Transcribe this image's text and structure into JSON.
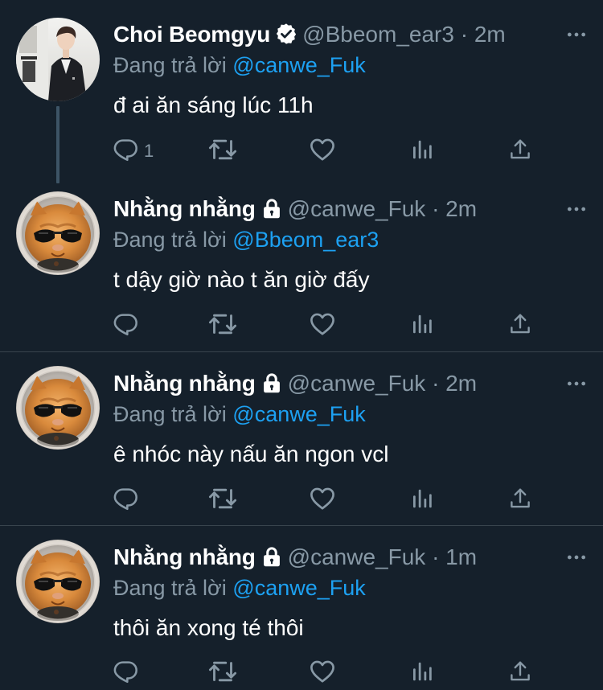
{
  "colors": {
    "background": "#15202b",
    "primary_text": "#ffffff",
    "secondary_text": "#8899a6",
    "accent": "#1da1f2",
    "divider": "#38444d",
    "thread_line": "#3d5466"
  },
  "tweets": [
    {
      "author_name": "Choi Beomgyu",
      "verified": true,
      "protected": false,
      "handle": "@Bbeom_ear3",
      "dot": "·",
      "time": "2m",
      "replying_prefix": "Đang trả lời",
      "replying_to": "@canwe_Fuk",
      "text": "đ ai ăn sáng lúc 11h",
      "reply_count": "1",
      "icons": [
        "verified-badge-icon",
        "more-icon",
        "reply-icon",
        "retweet-icon",
        "like-icon",
        "stats-icon",
        "share-icon"
      ]
    },
    {
      "author_name": "Nhằng nhằng",
      "verified": false,
      "protected": true,
      "handle": "@canwe_Fuk",
      "dot": "·",
      "time": "2m",
      "replying_prefix": "Đang trả lời",
      "replying_to": "@Bbeom_ear3",
      "text": "t dậy giờ nào t ăn giờ đấy",
      "reply_count": "",
      "icons": [
        "lock-icon",
        "more-icon",
        "reply-icon",
        "retweet-icon",
        "like-icon",
        "stats-icon",
        "share-icon"
      ]
    },
    {
      "author_name": "Nhằng nhằng",
      "verified": false,
      "protected": true,
      "handle": "@canwe_Fuk",
      "dot": "·",
      "time": "2m",
      "replying_prefix": "Đang trả lời",
      "replying_to": "@canwe_Fuk",
      "text": "ê nhóc này nấu ăn ngon vcl",
      "reply_count": "",
      "icons": [
        "lock-icon",
        "more-icon",
        "reply-icon",
        "retweet-icon",
        "like-icon",
        "stats-icon",
        "share-icon"
      ]
    },
    {
      "author_name": "Nhằng nhằng",
      "verified": false,
      "protected": true,
      "handle": "@canwe_Fuk",
      "dot": "·",
      "time": "1m",
      "replying_prefix": "Đang trả lời",
      "replying_to": "@canwe_Fuk",
      "text": "thôi ăn xong té thôi",
      "reply_count": "",
      "icons": [
        "lock-icon",
        "more-icon",
        "reply-icon",
        "retweet-icon",
        "like-icon",
        "stats-icon",
        "share-icon"
      ]
    }
  ]
}
